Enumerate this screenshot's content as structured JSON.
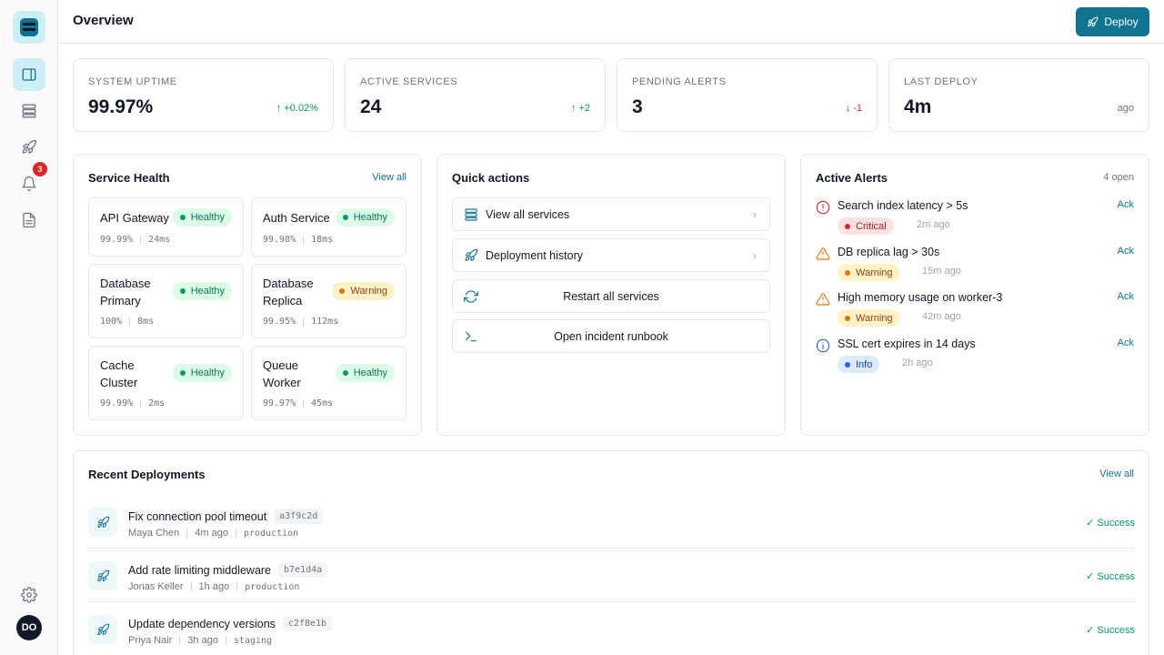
{
  "app": {
    "logo": "app-logo",
    "avatar_initials": "DO",
    "notification_count": "3"
  },
  "header": {
    "title": "Overview",
    "deploy_label": "Deploy"
  },
  "stats": [
    {
      "label": "SYSTEM UPTIME",
      "value": "99.97%",
      "delta": "+0.02%",
      "trend": "up"
    },
    {
      "label": "ACTIVE SERVICES",
      "value": "24",
      "delta": "+2",
      "trend": "up"
    },
    {
      "label": "PENDING ALERTS",
      "value": "3",
      "delta": "-1",
      "trend": "down"
    },
    {
      "label": "LAST DEPLOY",
      "value": "4m",
      "delta": "ago",
      "trend": "none"
    }
  ],
  "service_health": {
    "title": "Service Health",
    "view_all": "View all",
    "services": [
      {
        "name": "API Gateway",
        "status": "Healthy",
        "uptime": "99.99%",
        "latency": "24ms"
      },
      {
        "name": "Auth Service",
        "status": "Healthy",
        "uptime": "99.98%",
        "latency": "18ms"
      },
      {
        "name": "Database Primary",
        "status": "Healthy",
        "uptime": "100%",
        "latency": "8ms"
      },
      {
        "name": "Database Replica",
        "status": "Warning",
        "uptime": "99.95%",
        "latency": "112ms"
      },
      {
        "name": "Cache Cluster",
        "status": "Healthy",
        "uptime": "99.99%",
        "latency": "2ms"
      },
      {
        "name": "Queue Worker",
        "status": "Healthy",
        "uptime": "99.97%",
        "latency": "45ms"
      }
    ]
  },
  "quick_actions": {
    "title": "Quick actions",
    "items": [
      {
        "label": "View all services",
        "icon": "server-icon"
      },
      {
        "label": "Deployment history",
        "icon": "rocket-icon"
      },
      {
        "label": "Restart all services",
        "icon": "refresh-icon"
      },
      {
        "label": "Open incident runbook",
        "icon": "terminal-icon"
      }
    ]
  },
  "alerts": {
    "title": "Active Alerts",
    "count": "4 open",
    "ack_label": "Ack",
    "items": [
      {
        "title": "Search index latency > 5s",
        "severity": "Critical",
        "time": "2m ago"
      },
      {
        "title": "DB replica lag > 30s",
        "severity": "Warning",
        "time": "15m ago"
      },
      {
        "title": "High memory usage on worker-3",
        "severity": "Warning",
        "time": "42m ago"
      },
      {
        "title": "SSL cert expires in 14 days",
        "severity": "Info",
        "time": "2h ago"
      }
    ]
  },
  "deployments": {
    "title": "Recent Deployments",
    "view_all": "View all",
    "items": [
      {
        "title": "Fix connection pool timeout",
        "hash": "a3f9c2d",
        "author": "Maya Chen",
        "time": "4m ago",
        "env": "production",
        "status": "Success"
      },
      {
        "title": "Add rate limiting middleware",
        "hash": "b7e1d4a",
        "author": "Jonas Keller",
        "time": "1h ago",
        "env": "production",
        "status": "Success"
      },
      {
        "title": "Update dependency versions",
        "hash": "c2f8e1b",
        "author": "Priya Nair",
        "time": "3h ago",
        "env": "staging",
        "status": "Success"
      }
    ]
  },
  "colors": {
    "accent": "#0e7490",
    "success": "#059669",
    "danger": "#dc2626",
    "warning": "#d97706",
    "info": "#2563eb"
  }
}
